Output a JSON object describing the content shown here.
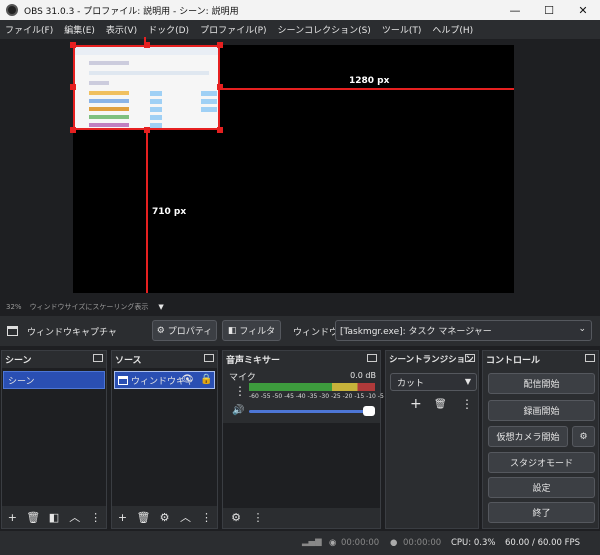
{
  "window": {
    "title": "OBS 31.0.3 - プロファイル: 説明用 - シーン: 説明用",
    "minimize": "—",
    "maximize": "☐",
    "close": "✕"
  },
  "menu": [
    "ファイル(F)",
    "編集(E)",
    "表示(V)",
    "ドック(D)",
    "プロファイル(P)",
    "シーンコレクション(S)",
    "ツール(T)",
    "ヘルプ(H)"
  ],
  "preview": {
    "width_label": "1280 px",
    "height_label": "710 px",
    "zoom": "32%",
    "scaling_mode": "ウィンドウサイズにスケーリング表示"
  },
  "source_toolbar": {
    "selected_source": "ウィンドウキャプチャ",
    "properties_label": "プロパティ",
    "filters_label": "フィルタ",
    "window_label": "ウィンドウ",
    "window_value": "[Taskmgr.exe]: タスク マネージャー"
  },
  "scenes": {
    "header": "シーン",
    "items": [
      "シーン"
    ]
  },
  "sources": {
    "header": "ソース",
    "items": [
      "ウィンドウキャ"
    ]
  },
  "mixer": {
    "header": "音声ミキサー",
    "track_name": "マイク",
    "level": "0.0 dB",
    "scale": "-60 -55 -50 -45 -40 -35 -30 -25 -20 -15 -10 -5 0"
  },
  "transitions": {
    "header": "シーントランジション",
    "selected": "カット"
  },
  "controls": {
    "header": "コントロール",
    "start_streaming": "配信開始",
    "start_recording": "録画開始",
    "virtual_camera": "仮想カメラ開始",
    "studio_mode": "スタジオモード",
    "settings": "設定",
    "exit": "終了"
  },
  "status": {
    "stream_time": "00:00:00",
    "record_time": "00:00:00",
    "cpu": "CPU: 0.3%",
    "fps": "60.00 / 60.00 FPS"
  },
  "colors": {
    "accent_red": "#e62020",
    "selection_blue": "#2a4fb3",
    "panel": "#2b2d30",
    "background": "#1e1f22"
  }
}
